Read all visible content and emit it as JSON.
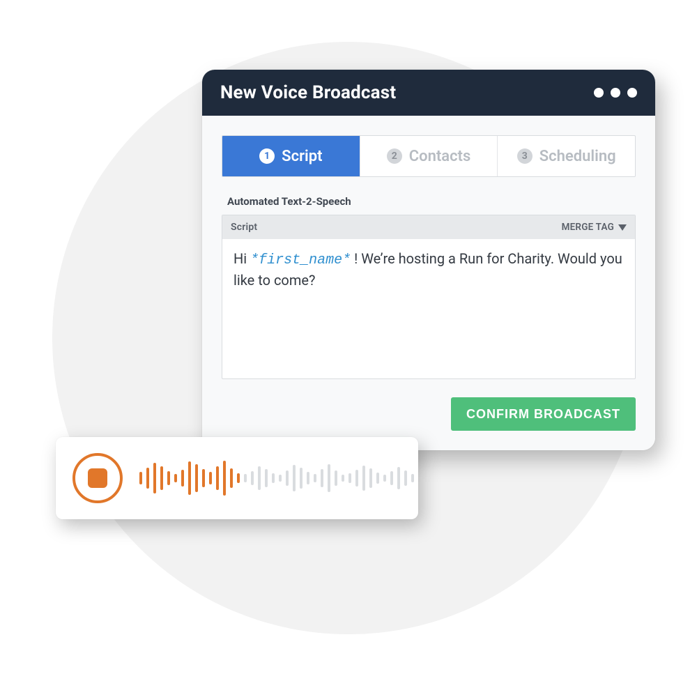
{
  "window": {
    "title": "New Voice Broadcast"
  },
  "tabs": [
    {
      "num": "1",
      "label": "Script",
      "active": true
    },
    {
      "num": "2",
      "label": "Contacts",
      "active": false
    },
    {
      "num": "3",
      "label": "Scheduling",
      "active": false
    }
  ],
  "section_label": "Automated Text-2-Speech",
  "editor": {
    "toolbar_label": "Script",
    "merge_tag_label": "MERGE TAG",
    "text_before": "Hi ",
    "merge_var": "*first_name*",
    "text_after": " ! We’re hosting a Run for Charity. Would you like to come?"
  },
  "confirm_label": "CONFIRM BROADCAST",
  "waveform": {
    "played_heights": [
      18,
      30,
      44,
      34,
      20,
      12,
      24,
      48,
      40,
      26,
      18,
      34,
      50,
      28,
      14
    ],
    "unplayed_heights": [
      12,
      20,
      34,
      26,
      14,
      10,
      22,
      38,
      30,
      18,
      12,
      26,
      40,
      22,
      10,
      14,
      24,
      36,
      28,
      16,
      10,
      20,
      32,
      22,
      12
    ]
  },
  "colors": {
    "accent_blue": "#3a78d6",
    "accent_orange": "#e1772a",
    "accent_green": "#4fbf7b",
    "titlebar_bg": "#1f2b3c"
  }
}
